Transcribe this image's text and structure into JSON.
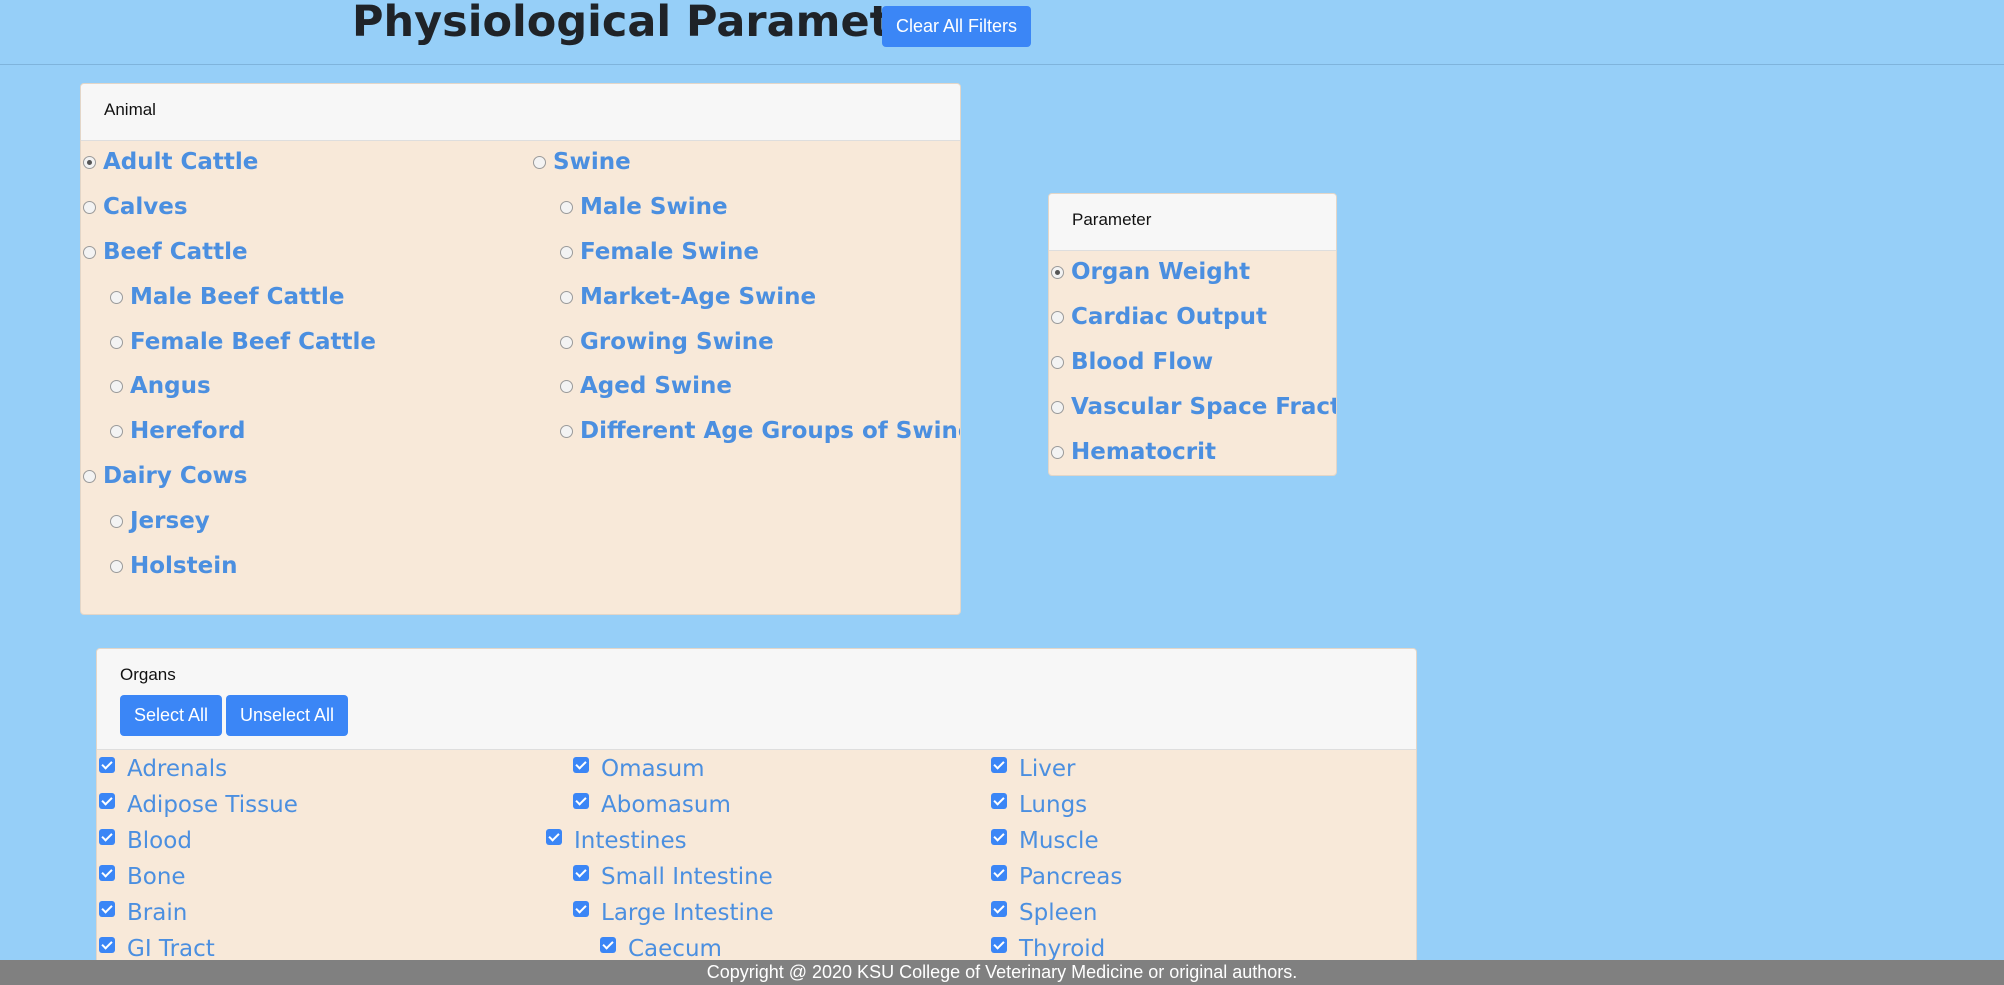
{
  "header": {
    "title": "Physiological Parameters",
    "clear_label": "Clear All Filters"
  },
  "animal": {
    "title": "Animal",
    "selected": "Adult Cattle",
    "items": [
      {
        "label": "Adult Cattle",
        "checked": true
      },
      {
        "label": "Calves",
        "checked": false
      },
      {
        "label": "Beef Cattle",
        "checked": false
      },
      {
        "label": "Male Beef Cattle",
        "checked": false
      },
      {
        "label": "Female Beef Cattle",
        "checked": false
      },
      {
        "label": "Angus",
        "checked": false
      },
      {
        "label": "Hereford",
        "checked": false
      },
      {
        "label": "Dairy Cows",
        "checked": false
      },
      {
        "label": "Jersey",
        "checked": false
      },
      {
        "label": "Holstein",
        "checked": false
      },
      {
        "label": "Swine",
        "checked": false
      },
      {
        "label": "Male Swine",
        "checked": false
      },
      {
        "label": "Female Swine",
        "checked": false
      },
      {
        "label": "Market-Age Swine",
        "checked": false
      },
      {
        "label": "Growing Swine",
        "checked": false
      },
      {
        "label": "Aged Swine",
        "checked": false
      },
      {
        "label": "Different Age Groups of Swine",
        "checked": false
      }
    ]
  },
  "parameter": {
    "title": "Parameter",
    "items": [
      {
        "label": "Organ Weight",
        "checked": true
      },
      {
        "label": "Cardiac Output",
        "checked": false
      },
      {
        "label": "Blood Flow",
        "checked": false
      },
      {
        "label": "Vascular Space Fraction",
        "checked": false
      },
      {
        "label": "Hematocrit",
        "checked": false
      }
    ]
  },
  "organs": {
    "title": "Organs",
    "select_all_label": "Select All",
    "unselect_all_label": "Unselect All",
    "items": [
      {
        "label": "Adrenals",
        "checked": true
      },
      {
        "label": "Adipose Tissue",
        "checked": true
      },
      {
        "label": "Blood",
        "checked": true
      },
      {
        "label": "Bone",
        "checked": true
      },
      {
        "label": "Brain",
        "checked": true
      },
      {
        "label": "GI Tract",
        "checked": true
      },
      {
        "label": "Omasum",
        "checked": true
      },
      {
        "label": "Abomasum",
        "checked": true
      },
      {
        "label": "Intestines",
        "checked": true
      },
      {
        "label": "Small Intestine",
        "checked": true
      },
      {
        "label": "Large Intestine",
        "checked": true
      },
      {
        "label": "Caecum",
        "checked": true
      },
      {
        "label": "Liver",
        "checked": true
      },
      {
        "label": "Lungs",
        "checked": true
      },
      {
        "label": "Muscle",
        "checked": true
      },
      {
        "label": "Pancreas",
        "checked": true
      },
      {
        "label": "Spleen",
        "checked": true
      },
      {
        "label": "Thyroid",
        "checked": true
      }
    ]
  },
  "footer": {
    "text": "Copyright @ 2020 KSU College of Veterinary Medicine or original authors."
  }
}
